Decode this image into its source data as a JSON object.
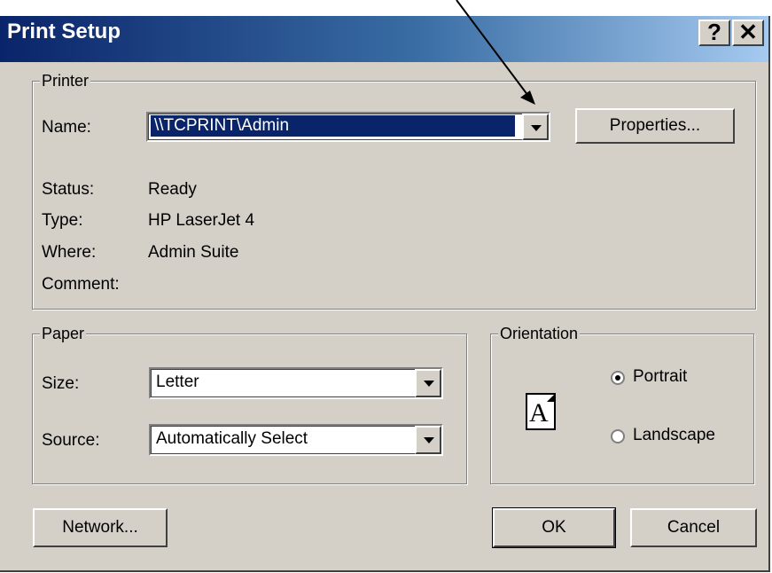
{
  "title": "Print Setup",
  "titlebar": {
    "help_label": "?",
    "close_label": "✕"
  },
  "printer": {
    "group_label": "Printer",
    "name_label": "Name:",
    "name_value": "\\\\TCPRINT\\Admin",
    "properties_label": "Properties...",
    "status_label": "Status:",
    "status_value": "Ready",
    "type_label": "Type:",
    "type_value": "HP LaserJet 4",
    "where_label": "Where:",
    "where_value": "Admin Suite",
    "comment_label": "Comment:"
  },
  "paper": {
    "group_label": "Paper",
    "size_label": "Size:",
    "size_value": "Letter",
    "source_label": "Source:",
    "source_value": "Automatically Select"
  },
  "orientation": {
    "group_label": "Orientation",
    "icon_glyph": "A",
    "portrait_label": "Portrait",
    "landscape_label": "Landscape",
    "selected": "Portrait"
  },
  "buttons": {
    "network": "Network...",
    "ok": "OK",
    "cancel": "Cancel"
  },
  "colors": {
    "titlebar_start": "#0a246a",
    "titlebar_end": "#a6caf0",
    "face": "#d4d0c8",
    "selection": "#0a246a"
  },
  "icons": [
    "help-icon",
    "close-icon",
    "dropdown-arrow-icon",
    "page-portrait-icon",
    "annotation-arrow"
  ]
}
